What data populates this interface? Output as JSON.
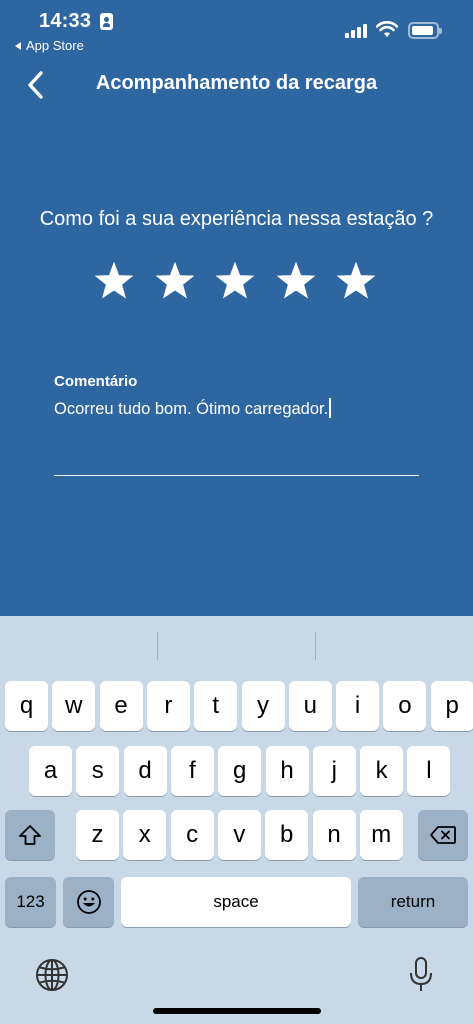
{
  "status_bar": {
    "time": "14:33",
    "back_app": "App Store",
    "icons": [
      "contact-card-icon",
      "cellular-signal-icon",
      "wifi-icon",
      "battery-icon"
    ]
  },
  "header": {
    "title": "Acompanhamento da recarga",
    "back_icon": "chevron-left-icon"
  },
  "rating": {
    "question": "Como foi a sua experiência nessa estação ?",
    "stars_total": 5,
    "stars_selected": 5,
    "star_color": "#ffffff"
  },
  "comment": {
    "label": "Comentário",
    "value": "Ocorreu tudo bom. Ótimo carregador."
  },
  "keyboard": {
    "row1": [
      "q",
      "w",
      "e",
      "r",
      "t",
      "y",
      "u",
      "i",
      "o",
      "p"
    ],
    "row2": [
      "a",
      "s",
      "d",
      "f",
      "g",
      "h",
      "j",
      "k",
      "l"
    ],
    "row3": [
      "z",
      "x",
      "c",
      "v",
      "b",
      "n",
      "m"
    ],
    "numbers_label": "123",
    "space_label": "space",
    "return_label": "return",
    "icons": [
      "shift-icon",
      "backspace-icon",
      "emoji-icon",
      "globe-icon",
      "microphone-icon"
    ]
  },
  "colors": {
    "background": "#2d66a0",
    "keyboard_background": "#c9d8e6",
    "special_key": "#9cb0c6"
  }
}
